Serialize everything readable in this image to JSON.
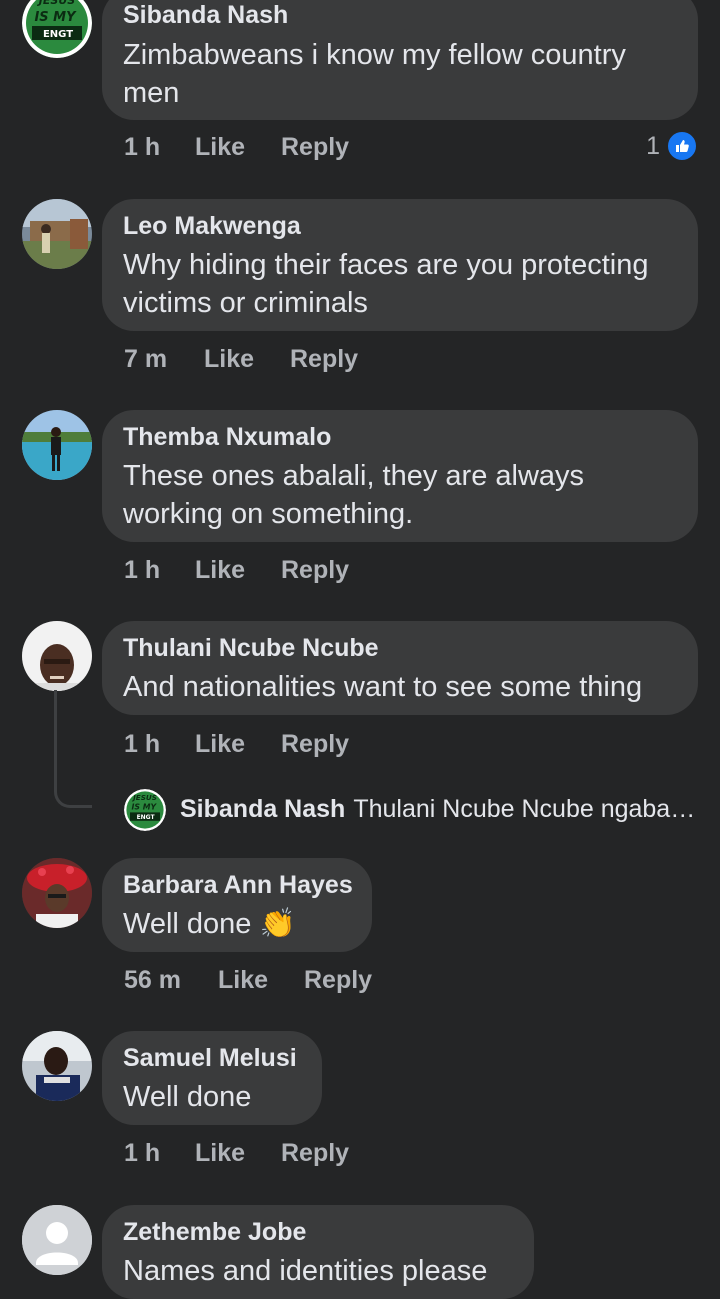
{
  "comments": [
    {
      "name": "Sibanda Nash",
      "text": "Zimbabweans i know my fellow country men",
      "time": "1 h",
      "like": "Like",
      "reply": "Reply",
      "reaction_count": "1"
    },
    {
      "name": "Leo Makwenga",
      "text": "Why hiding their faces are you protecting victims or criminals",
      "time": "7 m",
      "like": "Like",
      "reply": "Reply"
    },
    {
      "name": "Themba Nxumalo",
      "text": "These ones abalali, they are always working on something.",
      "time": "1 h",
      "like": "Like",
      "reply": "Reply"
    },
    {
      "name": "Thulani Ncube Ncube",
      "text": "And nationalities want to see some thing",
      "time": "1 h",
      "like": "Like",
      "reply": "Reply",
      "reply_preview": {
        "name": "Sibanda Nash",
        "text": "Thulani Ncube Ncube ngabak..."
      }
    },
    {
      "name": "Barbara Ann Hayes",
      "text": "Well done 👏",
      "time": "56 m",
      "like": "Like",
      "reply": "Reply"
    },
    {
      "name": "Samuel Melusi",
      "text": "Well done",
      "time": "1 h",
      "like": "Like",
      "reply": "Reply"
    },
    {
      "name": "Zethembe Jobe",
      "text": "Names and identities please"
    }
  ],
  "avatar_logo_text": [
    "JESUS",
    "IS MY",
    "ENGT"
  ],
  "colors": {
    "background": "#242526",
    "bubble": "#3a3b3c",
    "text": "#e4e6eb",
    "meta": "#b0b3b8",
    "like_badge": "#1877f2"
  }
}
